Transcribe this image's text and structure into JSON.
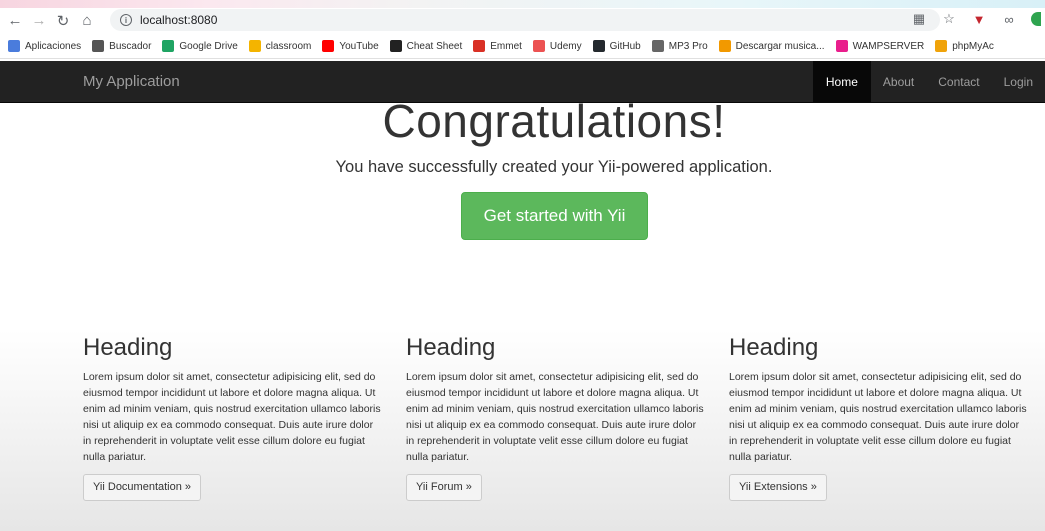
{
  "browser": {
    "url": "localhost:8080",
    "bookmarks": [
      {
        "label": "Aplicaciones",
        "color": "#4a7cdc"
      },
      {
        "label": "Buscador",
        "color": "#555555"
      },
      {
        "label": "Google Drive",
        "color": "#1fa463"
      },
      {
        "label": "classroom",
        "color": "#f4b400"
      },
      {
        "label": "YouTube",
        "color": "#ff0000"
      },
      {
        "label": "Cheat Sheet",
        "color": "#222222"
      },
      {
        "label": "Emmet",
        "color": "#d93025"
      },
      {
        "label": "Udemy",
        "color": "#ec5252"
      },
      {
        "label": "GitHub",
        "color": "#24292e"
      },
      {
        "label": "MP3 Pro",
        "color": "#666666"
      },
      {
        "label": "Descargar musica...",
        "color": "#f29900"
      },
      {
        "label": "WAMPSERVER",
        "color": "#e91e8c"
      },
      {
        "label": "phpMyAc",
        "color": "#f0a30a"
      }
    ]
  },
  "app": {
    "brand": "My Application",
    "nav": [
      {
        "label": "Home",
        "active": true
      },
      {
        "label": "About",
        "active": false
      },
      {
        "label": "Contact",
        "active": false
      },
      {
        "label": "Login",
        "active": false
      }
    ],
    "jumbotron": {
      "title": "Congratulations!",
      "lead": "You have successfully created your Yii-powered application.",
      "button": "Get started with Yii"
    },
    "columns": [
      {
        "heading": "Heading",
        "text": "Lorem ipsum dolor sit amet, consectetur adipisicing elit, sed do eiusmod tempor incididunt ut labore et dolore magna aliqua. Ut enim ad minim veniam, quis nostrud exercitation ullamco laboris nisi ut aliquip ex ea commodo consequat. Duis aute irure dolor in reprehenderit in voluptate velit esse cillum dolore eu fugiat nulla pariatur.",
        "button": "Yii Documentation »"
      },
      {
        "heading": "Heading",
        "text": "Lorem ipsum dolor sit amet, consectetur adipisicing elit, sed do eiusmod tempor incididunt ut labore et dolore magna aliqua. Ut enim ad minim veniam, quis nostrud exercitation ullamco laboris nisi ut aliquip ex ea commodo consequat. Duis aute irure dolor in reprehenderit in voluptate velit esse cillum dolore eu fugiat nulla pariatur.",
        "button": "Yii Forum »"
      },
      {
        "heading": "Heading",
        "text": "Lorem ipsum dolor sit amet, consectetur adipisicing elit, sed do eiusmod tempor incididunt ut labore et dolore magna aliqua. Ut enim ad minim veniam, quis nostrud exercitation ullamco laboris nisi ut aliquip ex ea commodo consequat. Duis aute irure dolor in reprehenderit in voluptate velit esse cillum dolore eu fugiat nulla pariatur.",
        "button": "Yii Extensions »"
      }
    ]
  },
  "colors": {
    "navbar_bg": "#222222",
    "success_green": "#5cb85c"
  }
}
